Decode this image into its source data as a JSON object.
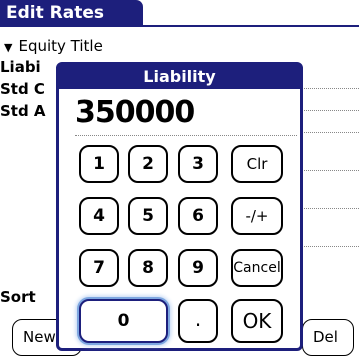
{
  "form": {
    "title": "Edit Rates",
    "category": "Equity Title",
    "rows": [
      {
        "label": "Liabi"
      },
      {
        "label": "Std C"
      },
      {
        "label": "Std A"
      }
    ],
    "sort_label": "Sort",
    "buttons": {
      "new_label": "New",
      "del_label": "Del"
    }
  },
  "keypad": {
    "title": "Liability",
    "value": "350000",
    "keys": {
      "k1": "1",
      "k2": "2",
      "k3": "3",
      "clr": "Clr",
      "k4": "4",
      "k5": "5",
      "k6": "6",
      "sign": "-/+",
      "k7": "7",
      "k8": "8",
      "k9": "9",
      "cancel": "Cancel",
      "k0": "0",
      "dot": ".",
      "ok": "OK"
    }
  }
}
